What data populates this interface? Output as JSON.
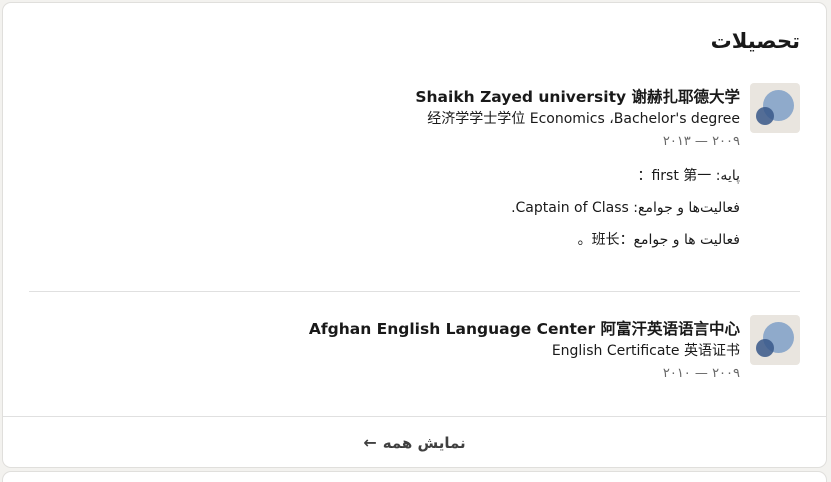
{
  "section": {
    "title": "تحصیلات"
  },
  "education": [
    {
      "school": "Shaikh Zayed university 谢赫扎耶德大学",
      "degree": "经济学学士学位 Economics ،Bachelor's degree",
      "dates": "۲۰۰۹ — ۲۰۱۳",
      "grade": "پایه: first 第一：",
      "activities_fa": "فعالیت‌ها و جوامع: Captain of Class.",
      "activities_zh": "فعالیت ها و جوامع：班长。"
    },
    {
      "school": "Afghan  English Language Center 阿富汗英语语言中心",
      "degree": "English Certificate 英语证书",
      "dates": "۲۰۰۹ — ۲۰۱۰"
    }
  ],
  "footer": {
    "show_all_label": "نمایش همه",
    "show_all_icon": "arrow-left-icon"
  }
}
